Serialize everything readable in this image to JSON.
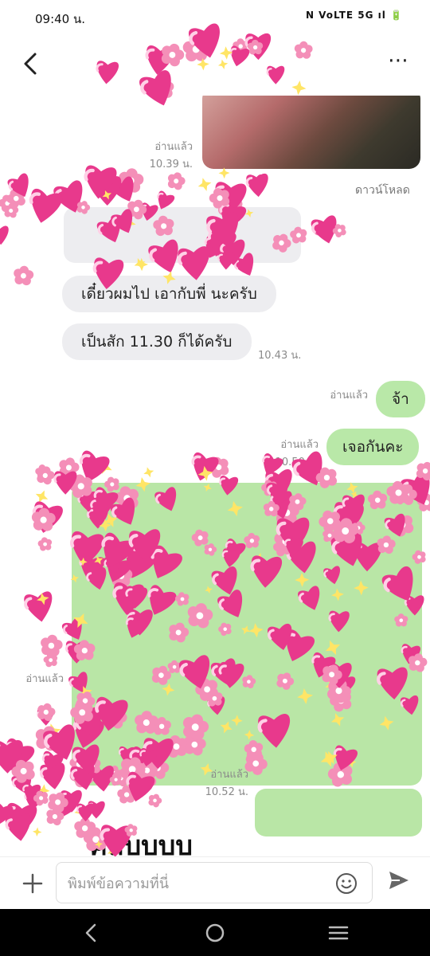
{
  "status_bar": {
    "time": "09:40 น.",
    "indicators": "N VoLTE 5G ıl 🔋"
  },
  "header": {
    "back_icon": "chevron-left-icon",
    "more_label": "⋯"
  },
  "messages": {
    "img1_read": "อ่านแล้ว",
    "img1_time": "10.39 น.",
    "download_label": "ดาวน์โหลด",
    "in1_text": "เดี๋ยวผมไป เอากับพี่ นะครับ",
    "in2_text": "เป็นสัก 11.30 ก็ได้ครับ",
    "in2_time": "10.43 น.",
    "out1_read": "อ่านแล้ว",
    "out1_text": "จ้า",
    "out2_read": "อ่านแล้ว",
    "out2_time": "10.50 น.",
    "out2_text": "เจอกันคะ",
    "img2_read": "อ่านแล้ว",
    "img3_read": "อ่านแล้ว",
    "img3_time": "10.52 น.",
    "partial_text": "คลิบบบบ"
  },
  "input": {
    "placeholder": "พิมพ์ข้อความที่นี่"
  },
  "colors": {
    "incoming": "#ededf0",
    "outgoing": "#b9e8a8",
    "sticker": "#e8398c"
  }
}
